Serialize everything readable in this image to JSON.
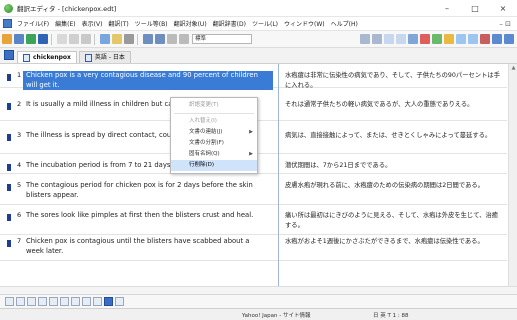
{
  "window": {
    "title": "翻訳エディタ - [chickenpox.edt]",
    "minimize": "–",
    "maximize": "□",
    "close": "×"
  },
  "menu": {
    "items": [
      "ファイル(F)",
      "編集(E)",
      "表示(V)",
      "翻訳(T)",
      "ツール等(B)",
      "翻訳対象(U)",
      "翻訳辞書(D)",
      "ツール(L)",
      "ウィンドウ(W)",
      "ヘルプ(H)"
    ],
    "right": "– ⊡"
  },
  "toolbar": {
    "select_value": "標準"
  },
  "tabs": [
    {
      "label": "chickenpox",
      "active": true
    },
    {
      "label": "英語 - 日本",
      "active": false
    }
  ],
  "rows": [
    {
      "num": "1",
      "en": "Chicken pox is a very contagious disease and 90 percent of children will get it.",
      "ja": "水疱瘡は非常に伝染性の病気であり、そして、子供たちの90パーセントは手に入れる。",
      "selected": true
    },
    {
      "num": "2",
      "en": "It is usually a mild illness in children but can be serious in adults.",
      "ja": "それは通常子供たちの軽い病気であるが、大人の重態でありえる。",
      "selected": false
    },
    {
      "num": "3",
      "en": "The illness is spread by direct contact, coughing or sneezing.",
      "ja": "病気は、直接接触によって、または、せきとくしゃみによって蔓延する。",
      "selected": false
    },
    {
      "num": "4",
      "en": "The incubation period is from 7 to 21 days.",
      "ja": "潜伏期間は、7から21日までである。",
      "selected": false
    },
    {
      "num": "5",
      "en": "The contagious period for chicken pox is for 2 days before the skin blisters appear.",
      "ja": "皮膚水疱が現れる前に、水疱瘡のための伝染病の期間は2日間である。",
      "selected": false
    },
    {
      "num": "6",
      "en": "The sores look like pimples at first then the blisters crust and heal.",
      "ja": "痛い所は最初はにきびのように見える、そして、水疱は外皮を生じて、治癒する。",
      "selected": false
    },
    {
      "num": "7",
      "en": "Chicken pox is contagious until the blisters have scabbed about a week later.",
      "ja": "水疱がおよそ1週後にかさぶたができるまで、水疱瘡は伝染性である。",
      "selected": false
    }
  ],
  "context_menu": {
    "items": [
      {
        "label": "訳語変更(T)",
        "disabled": true,
        "submenu": false
      },
      {
        "label": "",
        "separator": true
      },
      {
        "label": "入れ替え(I)",
        "disabled": true,
        "submenu": false
      },
      {
        "label": "文書の連結(J)",
        "disabled": false,
        "submenu": true
      },
      {
        "label": "文書の分割(F)",
        "disabled": false,
        "submenu": false
      },
      {
        "label": "固有名詞(Q)",
        "disabled": false,
        "submenu": true
      },
      {
        "label": "行削除(D)",
        "disabled": false,
        "submenu": false,
        "highlighted": true
      }
    ]
  },
  "status": {
    "middle": "Yahoo! Japan - サイト情報",
    "right": "日 英 T    1 : 88"
  }
}
